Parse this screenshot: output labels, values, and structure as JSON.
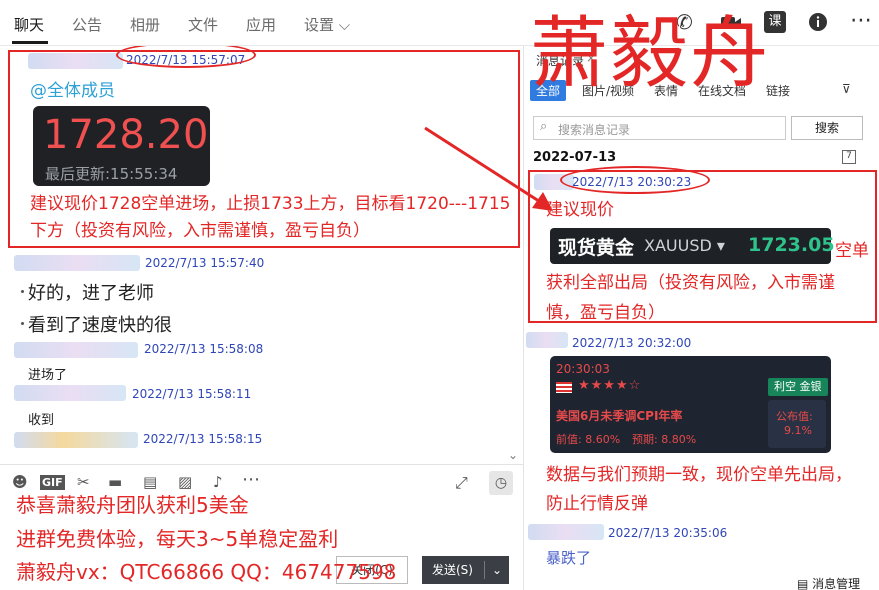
{
  "tabs": [
    {
      "label": "聊天"
    },
    {
      "label": "公告"
    },
    {
      "label": "相册"
    },
    {
      "label": "文件"
    },
    {
      "label": "应用"
    },
    {
      "label": "设置 ⌵"
    }
  ],
  "top_icons": [
    "phone-icon",
    "video-icon",
    "course-icon",
    "info-icon",
    "more-icon"
  ],
  "top_icon_glyphs": {
    "course": "课"
  },
  "chat": {
    "msg1": {
      "time": "2022/7/13 15:57:07",
      "mention": "@全体成员",
      "price": "1728.20",
      "updated": "最后更新:15:55:34",
      "text": "建议现价1728空单进场，止损1733上方，目标看1720---1715下方（投资有风险，入市需谨慎，盈亏自负）"
    },
    "msg2": {
      "time": "2022/7/13 15:57:40",
      "lines": [
        "好的，进了老师",
        "看到了速度快的很"
      ]
    },
    "msg3": {
      "time": "2022/7/13 15:58:08",
      "text": "进场了"
    },
    "msg4": {
      "time": "2022/7/13 15:58:11",
      "text": "收到"
    },
    "msg5": {
      "time": "2022/7/13 15:58:15"
    }
  },
  "composer": {
    "tools": [
      "emoji-icon",
      "gif-icon",
      "scissors-icon",
      "folder-icon",
      "file-icon",
      "image-icon",
      "bell-icon",
      "more-icon"
    ],
    "gif_label": "GIF",
    "promo_lines": [
      "恭喜萧毅舟团队获利5美金",
      "进群免费体验，每天3~5单稳定盈利",
      "萧毅舟vx：QTC66866  QQ：467477598"
    ],
    "close_label": "关闭(C)",
    "send_label": "发送(S)"
  },
  "watermark": "萧毅舟",
  "right": {
    "title": "消息记录",
    "tabs": [
      "全部",
      "图片/视频",
      "表情",
      "在线文档",
      "链接"
    ],
    "search_placeholder": "搜索消息记录",
    "search_button": "搜索",
    "date": "2022-07-13",
    "calendar_glyph": "7",
    "msg1": {
      "time": "2022/7/13 20:30:23",
      "line1": "建议现价",
      "xau_name": "现货黄金",
      "xau_code": "XAUUSD ▾",
      "xau_value": "1723.05",
      "tail": "空单",
      "line2": "获利全部出局（投资有风险，入市需谨",
      "line3": "慎，盈亏自负）"
    },
    "msg2": {
      "time": "2022/7/13 20:32:00",
      "cpi_time": "20:30:03",
      "stars": "★★★★☆",
      "badge": "利空 金银",
      "cpi_title": "美国6月未季调CPI年率",
      "prev": "前值: 8.60%",
      "expected": "预期: 8.80%",
      "published_label": "公布值:",
      "published_value": "9.1%",
      "text": "数据与我们预期一致，现价空单先出局，防止行情反弹"
    },
    "msg3": {
      "time": "2022/7/13 20:35:06",
      "text": "暴跌了"
    },
    "manage_label": "消息管理"
  }
}
